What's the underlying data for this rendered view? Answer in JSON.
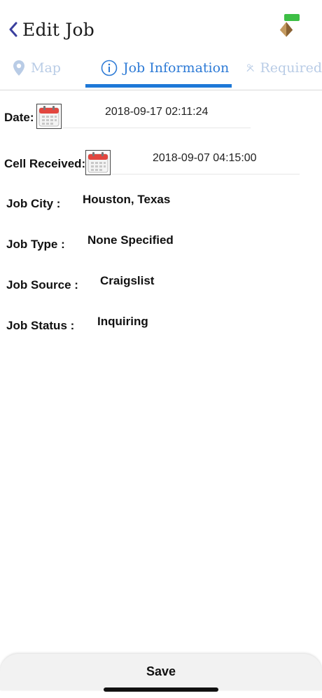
{
  "header": {
    "title": "Edit Job",
    "back_icon": "chevron-left-icon",
    "logo_icon": "pyramid-logo"
  },
  "tabs": [
    {
      "label": "Map",
      "icon": "map-pin-icon",
      "active": false
    },
    {
      "label": "Job Information",
      "icon": "info-circle-icon",
      "active": true
    },
    {
      "label": "Required",
      "icon": "tools-icon",
      "active": false
    }
  ],
  "colors": {
    "accent": "#1e78d8",
    "inactive_tab": "#b9cce6",
    "calendar_red": "#e2463f"
  },
  "fields": {
    "date": {
      "label": "Date:",
      "value": "2018-09-17 02:11:24"
    },
    "cell_received": {
      "label": "Cell Received:",
      "value": "2018-09-07 04:15:00"
    },
    "job_city": {
      "label": "Job City :",
      "value": "Houston, Texas"
    },
    "job_type": {
      "label": "Job Type :",
      "value": "None Specified"
    },
    "job_source": {
      "label": "Job Source :",
      "value": "Craigslist"
    },
    "job_status": {
      "label": "Job Status :",
      "value": "Inquiring"
    }
  },
  "footer": {
    "save_label": "Save"
  }
}
